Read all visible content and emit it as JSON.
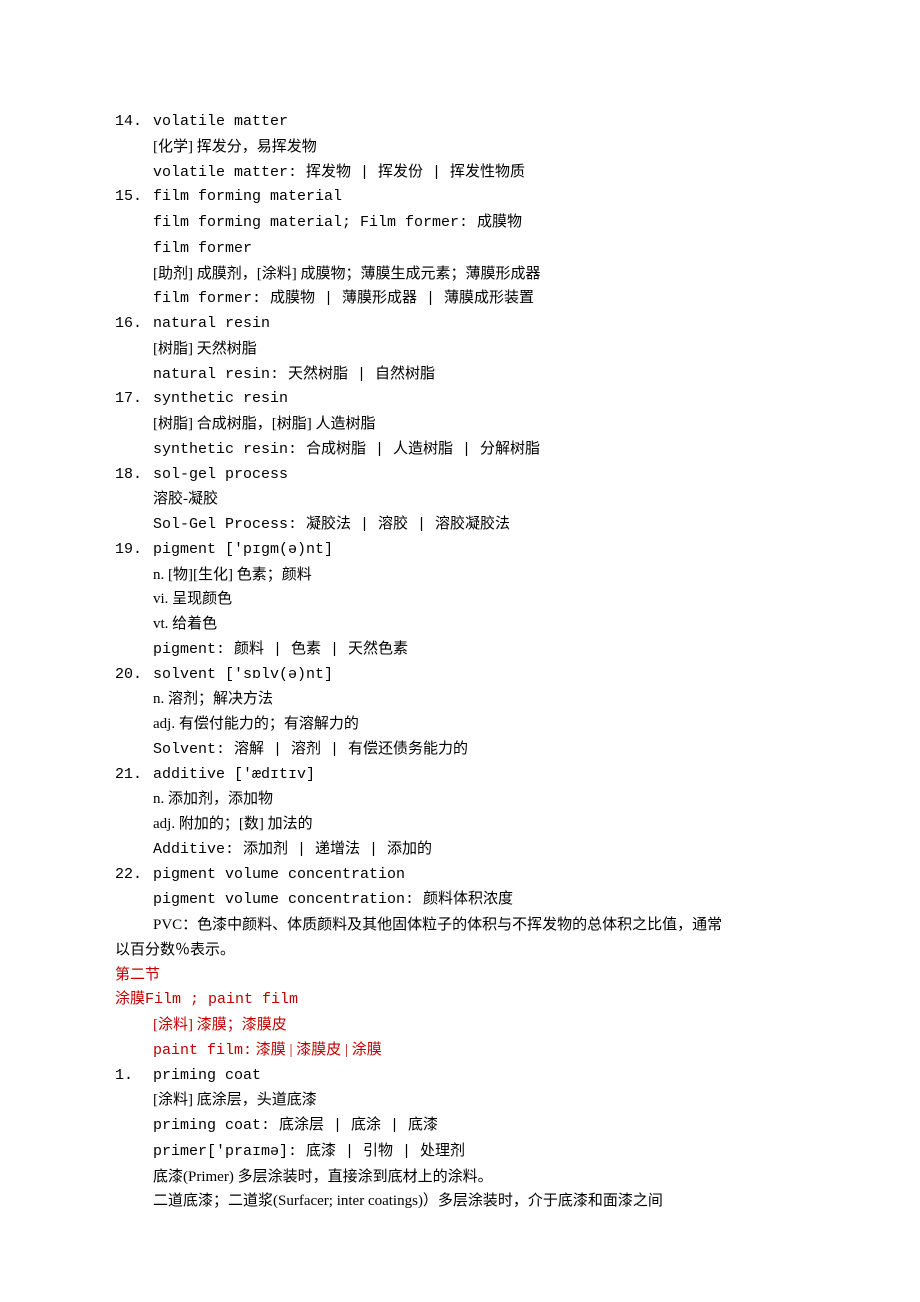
{
  "entries": [
    {
      "num": "14.",
      "term": "volatile matter",
      "subs": [
        "[化学] 挥发分，易挥发物",
        "volatile matter: 挥发物 | 挥发份 | 挥发性物质"
      ]
    },
    {
      "num": "15.",
      "term": "film forming material",
      "subs": [
        "film forming material; Film former: 成膜物",
        "film former",
        "[助剂] 成膜剂，[涂料] 成膜物；薄膜生成元素；薄膜形成器",
        "film former: 成膜物 | 薄膜形成器 | 薄膜成形装置"
      ]
    },
    {
      "num": "16.",
      "term": "natural resin",
      "subs": [
        "[树脂] 天然树脂",
        "natural resin: 天然树脂 | 自然树脂"
      ]
    },
    {
      "num": "17.",
      "term": "synthetic resin",
      "subs": [
        "[树脂] 合成树脂，[树脂] 人造树脂",
        "synthetic resin: 合成树脂 | 人造树脂 | 分解树脂"
      ]
    },
    {
      "num": "18.",
      "term": "sol-gel process",
      "subs": [
        "溶胶-凝胶",
        "Sol-Gel Process: 凝胶法 | 溶胶 | 溶胶凝胶法"
      ]
    },
    {
      "num": "19.",
      "term": "pigment ['pɪgm(ə)nt]",
      "subs": [
        "n. [物][生化] 色素；颜料",
        "vi. 呈现颜色",
        "vt. 给着色",
        "pigment: 颜料 | 色素 | 天然色素"
      ]
    },
    {
      "num": "20.",
      "term": "solvent ['sɒlv(ə)nt]",
      "subs": [
        "n. 溶剂；解决方法",
        "adj. 有偿付能力的；有溶解力的",
        "Solvent: 溶解 | 溶剂 | 有偿还债务能力的"
      ]
    },
    {
      "num": "21.",
      "term": "additive ['ædɪtɪv]",
      "subs": [
        "n. 添加剂，添加物",
        "adj. 附加的；[数] 加法的",
        "Additive: 添加剂 | 递增法 | 添加的"
      ]
    },
    {
      "num": "22.",
      "term": "pigment volume concentration",
      "subs": [
        "pigment volume concentration: 颜料体积浓度",
        "PVC：色漆中颜料、体质颜料及其他固体粒子的体积与不挥发物的总体积之比值，通常"
      ],
      "tail_noindent": "以百分数％表示。"
    }
  ],
  "section2": {
    "title": "第二节",
    "line1_prefix": "涂膜",
    "line1_mono": "Film ; paint film",
    "sub1": "[涂料] 漆膜；漆膜皮",
    "sub2_mono": "paint film:",
    "sub2_rest": " 漆膜 | 漆膜皮 | 涂膜"
  },
  "entries2": [
    {
      "num": "1.",
      "term": "priming coat",
      "subs": [
        "[涂料] 底涂层，头道底漆",
        "priming coat: 底涂层 | 底涂 | 底漆",
        "primer['praɪmə]: 底漆 | 引物 | 处理剂",
        "底漆(Primer) 多层涂装时，直接涂到底材上的涂料。",
        "二道底漆；二道浆(Surfacer; inter coatings)）多层涂装时，介于底漆和面漆之间"
      ]
    }
  ]
}
